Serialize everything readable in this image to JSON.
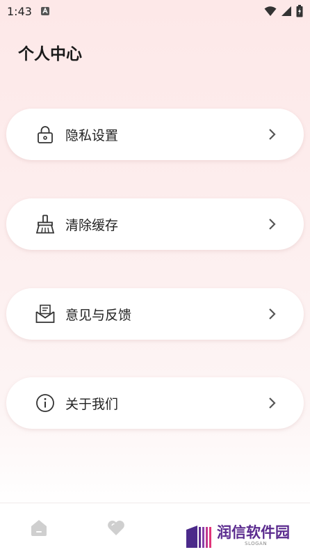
{
  "status_bar": {
    "time": "1:43"
  },
  "page": {
    "title": "个人中心"
  },
  "menu": [
    {
      "label": "隐私设置",
      "icon": "lock-icon"
    },
    {
      "label": "清除缓存",
      "icon": "broom-icon"
    },
    {
      "label": "意见与反馈",
      "icon": "envelope-icon"
    },
    {
      "label": "关于我们",
      "icon": "info-icon"
    }
  ],
  "tabs": [
    {
      "icon": "home-icon"
    },
    {
      "icon": "heart-icon"
    }
  ],
  "watermark": {
    "name": "润信软件园",
    "slogan": "SLOGAN"
  },
  "colors": {
    "background": "#fde8e8",
    "card": "#ffffff",
    "watermark": "#5b2b8f"
  }
}
